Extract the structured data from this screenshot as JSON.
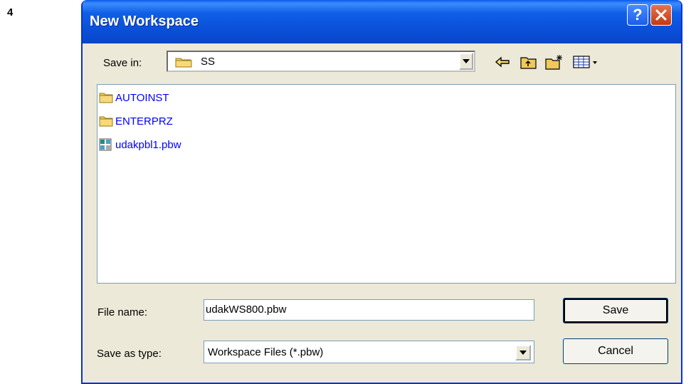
{
  "step_number": "4",
  "window": {
    "title": "New Workspace",
    "help_glyph": "?"
  },
  "save_in": {
    "label": "Save in:",
    "value": "SS",
    "icon": "folder-icon"
  },
  "toolbar": {
    "icons": [
      "back-arrow-icon",
      "up-one-level-icon",
      "create-new-folder-icon",
      "view-menu-icon"
    ]
  },
  "files": [
    {
      "name": "AUTOINST",
      "icon": "folder-icon"
    },
    {
      "name": "ENTERPRZ",
      "icon": "folder-icon"
    },
    {
      "name": "udakpbl1.pbw",
      "icon": "workspace-file-icon"
    }
  ],
  "file_name": {
    "label": "File name:",
    "value": "udakWS800.pbw"
  },
  "save_as_type": {
    "label": "Save as type:",
    "value": "Workspace Files (*.pbw)"
  },
  "buttons": {
    "save": "Save",
    "cancel": "Cancel"
  },
  "colors": {
    "titlebar": "#0a4fd8",
    "dialog_bg": "#ece9d8",
    "file_link": "#0000ff",
    "folder": "#f0c95a",
    "close_button": "#c23a12"
  }
}
